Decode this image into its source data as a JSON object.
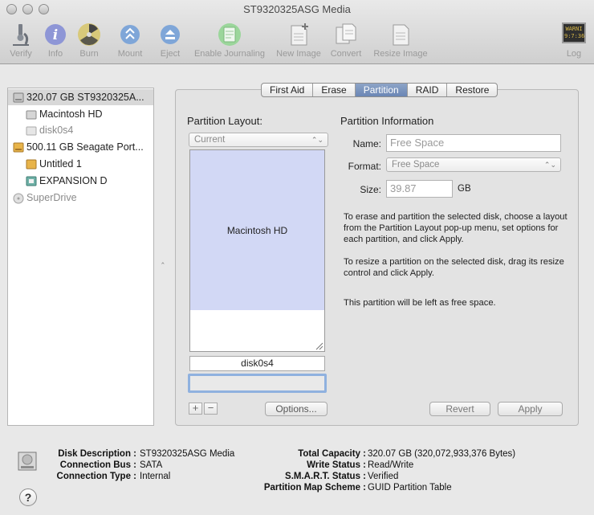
{
  "window": {
    "title": "ST9320325ASG Media"
  },
  "toolbar": {
    "verify": "Verify",
    "info": "Info",
    "burn": "Burn",
    "mount": "Mount",
    "eject": "Eject",
    "enable_journaling": "Enable Journaling",
    "new_image": "New Image",
    "convert": "Convert",
    "resize_image": "Resize Image",
    "log": "Log",
    "log_icon_text": "WARNI\n9:7:36"
  },
  "sidebar": {
    "items": [
      {
        "label": "320.07 GB ST9320325A...",
        "icon": "internal-disk-icon",
        "selected": true
      },
      {
        "label": "Macintosh HD",
        "icon": "volume-icon"
      },
      {
        "label": "disk0s4",
        "icon": "volume-icon",
        "dimmed": true
      },
      {
        "label": "500.11 GB Seagate Port...",
        "icon": "external-disk-icon"
      },
      {
        "label": "Untitled 1",
        "icon": "external-volume-icon"
      },
      {
        "label": "EXPANSION D",
        "icon": "external-volume-icon"
      },
      {
        "label": "SuperDrive",
        "icon": "optical-drive-icon",
        "dimmed": true
      }
    ]
  },
  "tabs": [
    "First Aid",
    "Erase",
    "Partition",
    "RAID",
    "Restore"
  ],
  "active_tab": "Partition",
  "partition_layout": {
    "heading": "Partition Layout:",
    "popup_value": "Current",
    "partitions": [
      {
        "name": "Macintosh HD",
        "color": "#d2d8f5"
      },
      {
        "name": "disk0s4",
        "color": "#ffffff"
      }
    ],
    "selected_partition_name": "disk0s4",
    "add_label": "+",
    "remove_label": "−",
    "options_button": "Options..."
  },
  "partition_info": {
    "heading": "Partition Information",
    "name_label": "Name:",
    "name_value": "Free Space",
    "format_label": "Format:",
    "format_value": "Free Space",
    "size_label": "Size:",
    "size_value": "39.87",
    "size_unit": "GB",
    "help_text_1": "To erase and partition the selected disk, choose a layout from the Partition Layout pop-up menu, set options for each partition, and click Apply.",
    "help_text_2": "To resize a partition on the selected disk, drag its resize control and click Apply.",
    "help_text_3": "This partition will be left as free space.",
    "revert_button": "Revert",
    "apply_button": "Apply"
  },
  "disk_info": {
    "disk_description_label": "Disk Description :",
    "disk_description_value": "ST9320325ASG Media",
    "connection_bus_label": "Connection Bus :",
    "connection_bus_value": "SATA",
    "connection_type_label": "Connection Type :",
    "connection_type_value": "Internal",
    "total_capacity_label": "Total Capacity :",
    "total_capacity_value": "320.07 GB (320,072,933,376 Bytes)",
    "write_status_label": "Write Status :",
    "write_status_value": "Read/Write",
    "smart_status_label": "S.M.A.R.T. Status :",
    "smart_status_value": "Verified",
    "partition_map_label": "Partition Map Scheme :",
    "partition_map_value": "GUID Partition Table"
  },
  "help_label": "?"
}
